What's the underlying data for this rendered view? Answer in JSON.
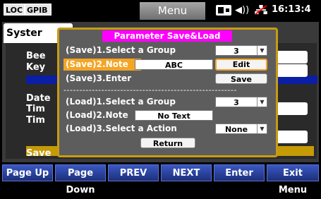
{
  "status": {
    "loc": "LOC",
    "gpib": "GPIB",
    "title": "Menu",
    "time": "16:13:4"
  },
  "background": {
    "tab_label": "Syster",
    "rows": [
      "Bee",
      "Key",
      "Date",
      "Tim",
      "Tim",
      "Save"
    ]
  },
  "dialog": {
    "title": "Parameter Save&Load",
    "save_group_label": "(Save)1.Select a Group",
    "save_group_value": "3",
    "save_note_label": "(Save)2.Note",
    "save_note_value": "ABC",
    "edit_button": "Edit",
    "save_enter_label": "(Save)3.Enter",
    "save_button": "Save",
    "separator": "-------------------------------------------------------",
    "load_group_label": "(Load)1.Select a Group",
    "load_group_value": "3",
    "load_note_label": "(Load)2.Note",
    "load_note_value": "No Text",
    "load_action_label": "(Load)3.Select a Action",
    "load_action_value": "None",
    "return_button": "Return"
  },
  "softkeys": [
    "Page Up",
    "Page Down",
    "PREV",
    "NEXT",
    "Enter",
    "Exit Menu"
  ],
  "colors": {
    "highlight": "#f4a524",
    "title_bg": "#ff00ff",
    "softkey": "#2a44a8"
  }
}
